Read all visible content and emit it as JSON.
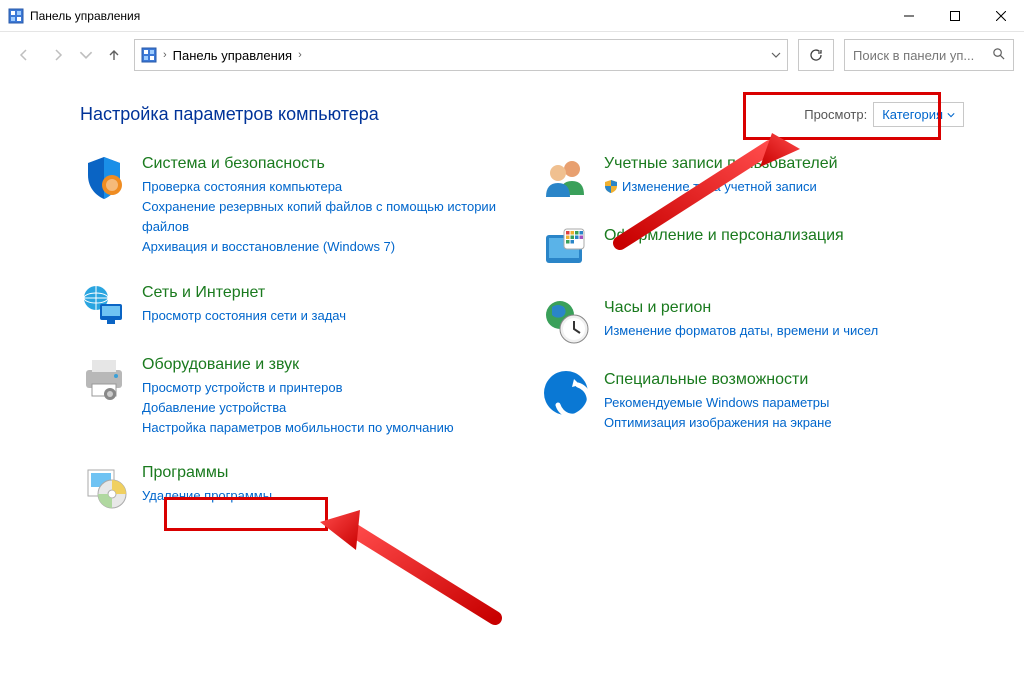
{
  "window": {
    "title": "Панель управления"
  },
  "nav": {
    "breadcrumb_root": "Панель управления"
  },
  "search": {
    "placeholder": "Поиск в панели уп..."
  },
  "heading": "Настройка параметров компьютера",
  "view": {
    "label": "Просмотр:",
    "value": "Категория"
  },
  "categories": {
    "system": {
      "title": "Система и безопасность",
      "subs": [
        "Проверка состояния компьютера",
        "Сохранение резервных копий файлов с помощью истории файлов",
        "Архивация и восстановление (Windows 7)"
      ]
    },
    "network": {
      "title": "Сеть и Интернет",
      "subs": [
        "Просмотр состояния сети и задач"
      ]
    },
    "hardware": {
      "title": "Оборудование и звук",
      "subs": [
        "Просмотр устройств и принтеров",
        "Добавление устройства",
        "Настройка параметров мобильности по умолчанию"
      ]
    },
    "programs": {
      "title": "Программы",
      "subs": [
        "Удаление программы"
      ]
    },
    "users": {
      "title": "Учетные записи пользователей",
      "shield_sub": "Изменение типа учетной записи"
    },
    "appearance": {
      "title": "Оформление и персонализация"
    },
    "clock": {
      "title": "Часы и регион",
      "subs": [
        "Изменение форматов даты, времени и чисел"
      ]
    },
    "ease": {
      "title": "Специальные возможности",
      "subs": [
        "Рекомендуемые Windows параметры",
        "Оптимизация изображения на экране"
      ]
    }
  }
}
